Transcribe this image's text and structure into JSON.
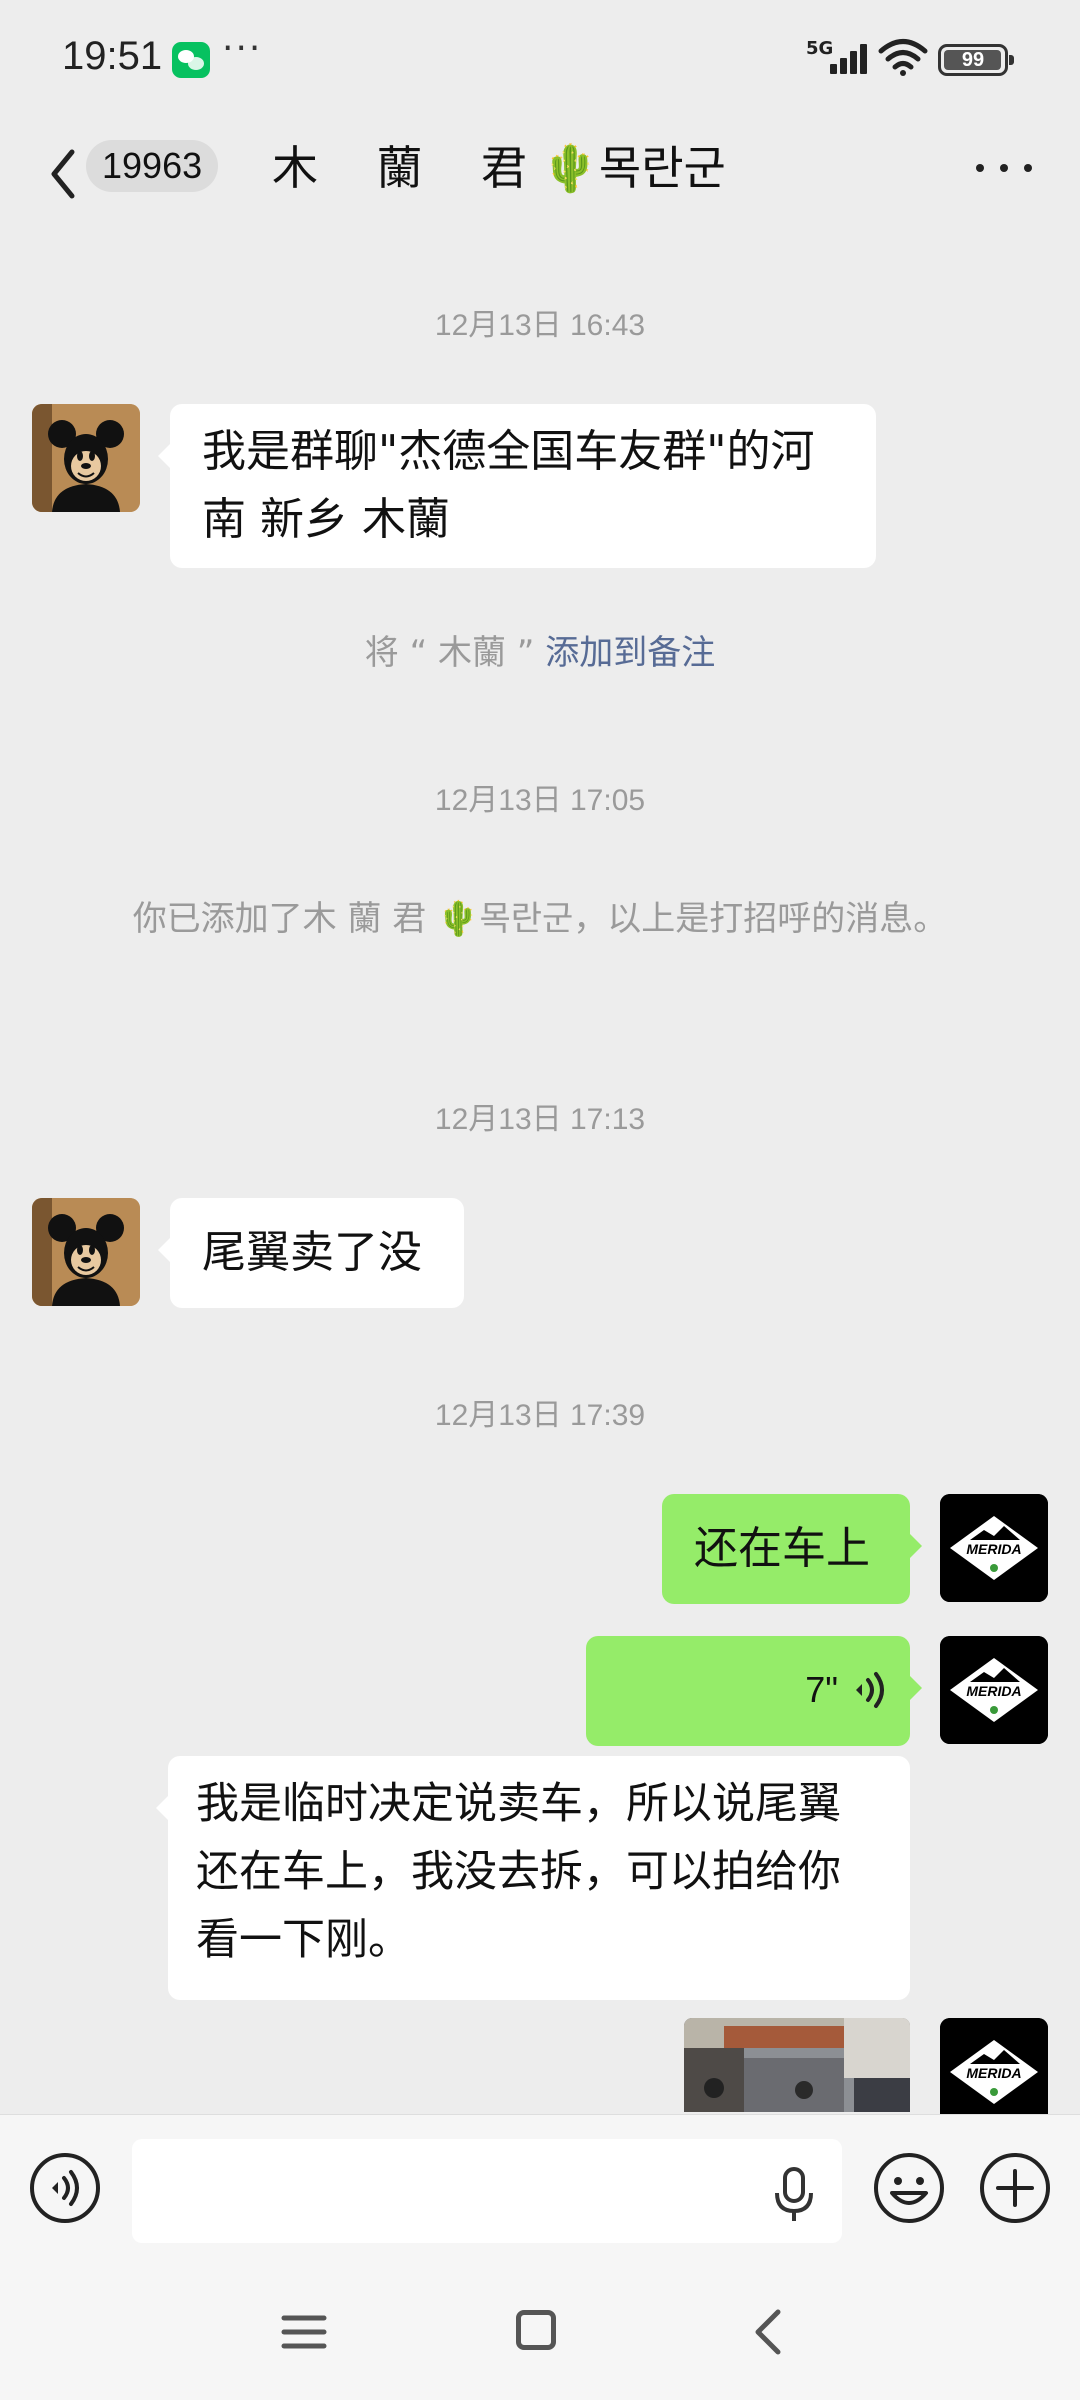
{
  "status_bar": {
    "time": "19:51",
    "more_indicator": "···",
    "network": "5G",
    "battery": "99",
    "battery_level": 0.99,
    "icons": [
      "wechat-icon",
      "signal-icon",
      "wifi-icon",
      "battery-icon"
    ]
  },
  "header": {
    "unread_count": "19963",
    "title": "木    蘭    君 🌵목란군",
    "icons": [
      "back-icon",
      "more-icon"
    ]
  },
  "messages": {
    "ts1": "12月13日 16:43",
    "m1_text": "我是群聊\"杰德全国车友群\"的河南    新乡 木蘭",
    "remark_prefix": "将 “ 木蘭 ” ",
    "remark_link": "添加到备注",
    "ts2": "12月13日 17:05",
    "added_note": "你已添加了木        蘭        君 🌵목란군，以上是打招呼的消息。",
    "ts3": "12月13日 17:13",
    "m2_text": "尾翼卖了没",
    "ts4": "12月13日 17:39",
    "m3_text": "还在车上",
    "m4_voice_duration": "7\"",
    "m5_text": "我是临时决定说卖车，所以说尾翼还在车上，我没去拆，可以拍给你看一下刚。"
  },
  "avatars": {
    "contact": "mickey-avatar",
    "self": "merida-logo-avatar",
    "self_logo_text": "MERIDA"
  },
  "input_bar": {
    "icons": [
      "voice-mode-icon",
      "microphone-icon",
      "emoji-icon",
      "plus-icon"
    ]
  },
  "system_nav": {
    "icons": [
      "menu-icon",
      "home-icon",
      "back-nav-icon"
    ]
  },
  "colors": {
    "background": "#ededed",
    "incoming_bubble": "#ffffff",
    "outgoing_bubble": "#95ec69",
    "link": "#576b95",
    "wechat_green": "#07c160"
  }
}
